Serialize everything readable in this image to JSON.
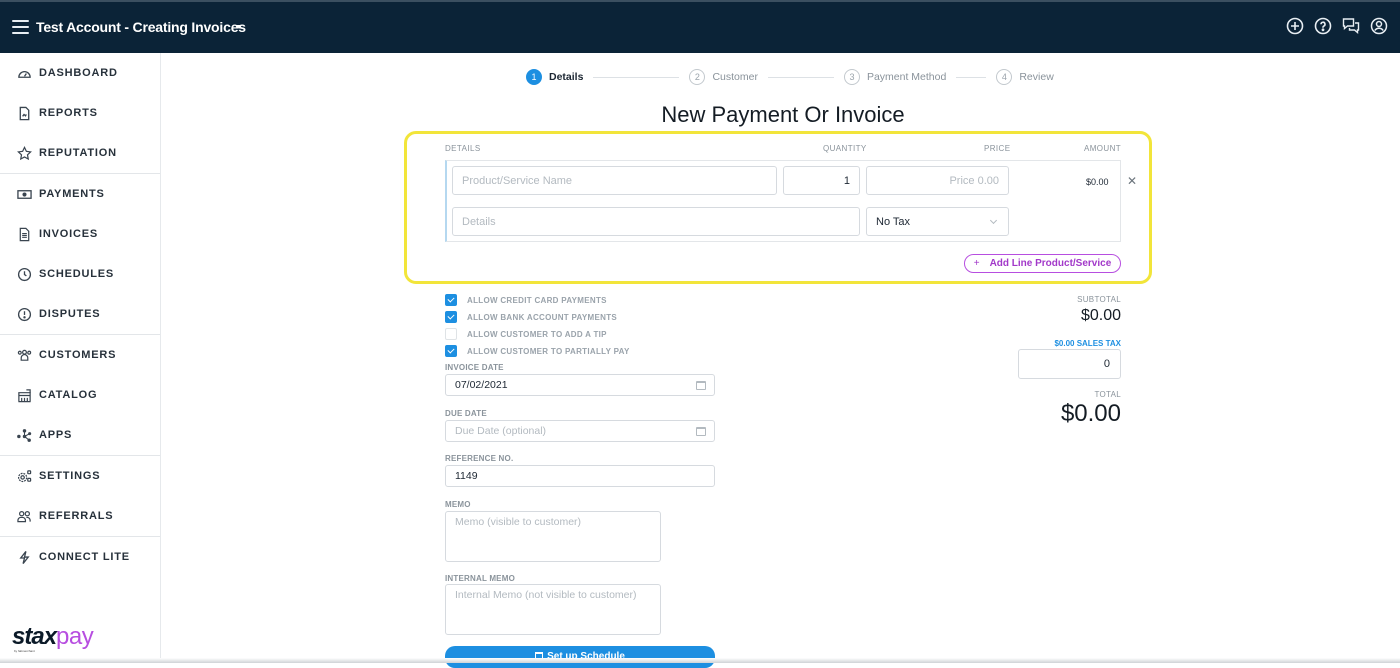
{
  "topbar": {
    "account_title": "Test Account - Creating Invoices",
    "icons": [
      "add-circle-icon",
      "help-icon",
      "chat-icon",
      "user-account-icon"
    ]
  },
  "sidebar": {
    "groups": [
      [
        {
          "label": "DASHBOARD",
          "icon": "dashboard-gauge-icon"
        },
        {
          "label": "REPORTS",
          "icon": "report-document-icon"
        },
        {
          "label": "REPUTATION",
          "icon": "star-icon"
        }
      ],
      [
        {
          "label": "PAYMENTS",
          "icon": "cash-icon"
        },
        {
          "label": "INVOICES",
          "icon": "invoice-icon"
        },
        {
          "label": "SCHEDULES",
          "icon": "clock-icon"
        },
        {
          "label": "DISPUTES",
          "icon": "alert-circle-icon"
        }
      ],
      [
        {
          "label": "CUSTOMERS",
          "icon": "customers-icon"
        },
        {
          "label": "CATALOG",
          "icon": "catalog-store-icon"
        },
        {
          "label": "APPS",
          "icon": "apps-network-icon"
        }
      ],
      [
        {
          "label": "SETTINGS",
          "icon": "settings-gear-icon"
        },
        {
          "label": "REFERRALS",
          "icon": "referrals-users-icon"
        }
      ],
      [
        {
          "label": "CONNECT LITE",
          "icon": "lightning-icon"
        }
      ]
    ],
    "logo": {
      "left": "stax",
      "right": "pay",
      "tagline": "by fattmerchant",
      "accent": "#b74ee0"
    }
  },
  "stepper": {
    "steps": [
      {
        "num": "1",
        "label": "Details",
        "active": true
      },
      {
        "num": "2",
        "label": "Customer",
        "active": false
      },
      {
        "num": "3",
        "label": "Payment Method",
        "active": false
      },
      {
        "num": "4",
        "label": "Review",
        "active": false
      }
    ]
  },
  "page": {
    "title": "New Payment Or Invoice"
  },
  "line_items": {
    "headers": {
      "details": "DETAILS",
      "quantity": "QUANTITY",
      "price": "PRICE",
      "amount": "AMOUNT"
    },
    "rows": [
      {
        "name_placeholder": "Product/Service Name",
        "quantity": "1",
        "price_placeholder": "Price 0.00",
        "amount": "$0.00",
        "details_placeholder": "Details",
        "tax": "No Tax"
      }
    ],
    "add_line_label": "Add Line Product/Service",
    "add_line_plus": "+",
    "remove_symbol": "✕"
  },
  "options": [
    {
      "label": "ALLOW CREDIT CARD PAYMENTS",
      "checked": true
    },
    {
      "label": "ALLOW BANK ACCOUNT PAYMENTS",
      "checked": true
    },
    {
      "label": "ALLOW CUSTOMER TO ADD A TIP",
      "checked": false
    },
    {
      "label": "ALLOW CUSTOMER TO PARTIALLY PAY",
      "checked": true
    }
  ],
  "fields": {
    "invoice_date": {
      "label": "INVOICE DATE",
      "value": "07/02/2021"
    },
    "due_date": {
      "label": "DUE DATE",
      "placeholder": "Due Date (optional)"
    },
    "reference": {
      "label": "REFERENCE NO.",
      "value": "1149"
    },
    "memo": {
      "label": "MEMO",
      "placeholder": "Memo (visible to customer)"
    },
    "internal_memo": {
      "label": "INTERNAL MEMO",
      "placeholder": "Internal Memo (not visible to customer)"
    }
  },
  "schedule_button": "Set up Schedule",
  "totals": {
    "subtotal_label": "SUBTOTAL",
    "subtotal": "$0.00",
    "sales_tax_label": "$0.00 SALES TAX",
    "sales_tax_input": "0",
    "total_label": "TOTAL",
    "total": "$0.00"
  },
  "colors": {
    "topbar": "#0b2337",
    "primary_blue": "#1d8fe1",
    "accent_purple": "#b74ee0",
    "highlight_yellow": "#f2e53a"
  }
}
